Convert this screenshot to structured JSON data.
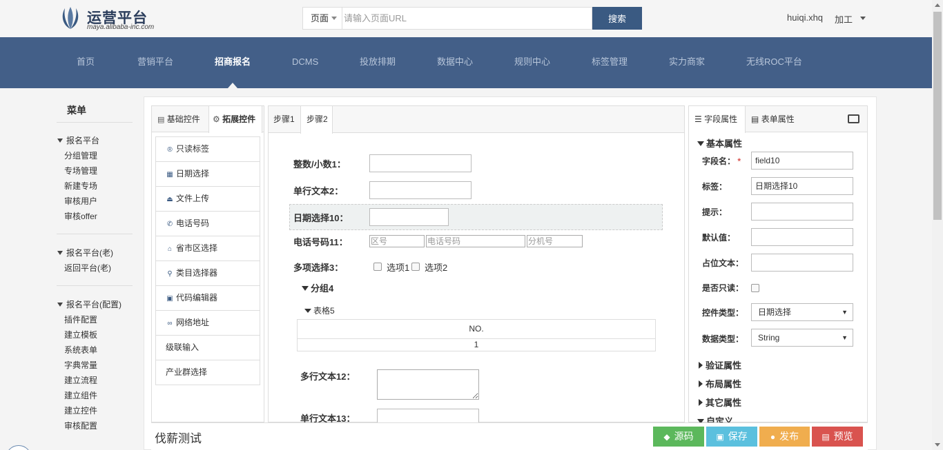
{
  "header": {
    "logo_title": "运营平台",
    "logo_subtitle": "maya.alibaba-inc.com",
    "search_scope": "页面",
    "search_placeholder": "请输入页面URL",
    "search_button": "搜索",
    "user": "huiqi.xhq",
    "process_menu": "加工"
  },
  "nav": {
    "items": [
      "首页",
      "营销平台",
      "招商报名",
      "DCMS",
      "投放排期",
      "数据中心",
      "规则中心",
      "标签管理",
      "实力商家",
      "无线ROC平台"
    ],
    "active": "招商报名"
  },
  "sidebar": {
    "title": "菜单",
    "groups": [
      {
        "label": "报名平台",
        "items": [
          "分组管理",
          "专场管理",
          "新建专场",
          "审核用户",
          "审核offer"
        ]
      },
      {
        "label": "报名平台(老)",
        "items": [
          "返回平台(老)"
        ]
      },
      {
        "label": "报名平台(配置)",
        "items": [
          "插件配置",
          "建立模板",
          "系统表单",
          "字典常量",
          "建立流程",
          "建立组件",
          "建立控件",
          "审核配置"
        ]
      }
    ]
  },
  "left_panel": {
    "tabs": [
      "基础控件",
      "拓展控件"
    ],
    "active_tab": "拓展控件",
    "controls": [
      {
        "label": "只读标签",
        "icon": "readonly-icon"
      },
      {
        "label": "日期选择",
        "icon": "calendar-icon"
      },
      {
        "label": "文件上传",
        "icon": "upload-icon"
      },
      {
        "label": "电话号码",
        "icon": "phone-icon"
      },
      {
        "label": "省市区选择",
        "icon": "region-icon"
      },
      {
        "label": "类目选择器",
        "icon": "category-icon"
      },
      {
        "label": "代码编辑器",
        "icon": "code-icon"
      },
      {
        "label": "网络地址",
        "icon": "link-icon"
      },
      {
        "label": "级联输入",
        "icon": ""
      },
      {
        "label": "产业群选择",
        "icon": ""
      }
    ]
  },
  "canvas": {
    "tabs": [
      "步骤1",
      "步骤2"
    ],
    "active_tab": "步骤2",
    "fields": {
      "int_label": "整数/小数1：",
      "text2_label": "单行文本2：",
      "date10_label": "日期选择10：",
      "phone11_label": "电话号码11：",
      "phone_area_placeholder": "区号",
      "phone_number_placeholder": "电话号码",
      "phone_ext_placeholder": "分机号",
      "multi3_label": "多项选择3：",
      "option1": "选项1",
      "option2": "选项2",
      "group4": "分组4",
      "table5": "表格5",
      "table_header": "NO.",
      "table_cell": "1",
      "textarea12_label": "多行文本12：",
      "text13_label": "单行文本13："
    }
  },
  "right_panel": {
    "tabs": [
      "字段属性",
      "表单属性"
    ],
    "active_tab": "字段属性",
    "basic_section": "基本属性",
    "props": {
      "name_label": "字段名：",
      "required_mark": "*",
      "name_value": "field10",
      "label_label": "标签：",
      "label_value": "日期选择10",
      "hint_label": "提示：",
      "default_label": "默认值：",
      "placeholder_label": "占位文本：",
      "readonly_label": "是否只读：",
      "control_type_label": "控件类型：",
      "control_type_value": "日期选择",
      "data_type_label": "数据类型：",
      "data_type_value": "String"
    },
    "collapsed_sections": [
      "验证属性",
      "布局属性",
      "其它属性"
    ],
    "custom_section": "自定义"
  },
  "footer": {
    "form_title": "伐薪测试",
    "buttons": {
      "source": "源码",
      "save": "保存",
      "publish": "发布",
      "preview": "预览"
    }
  },
  "colors": {
    "nav_bg": "#435f88",
    "search_btn": "#3a5a82",
    "source_btn": "#5cb85c",
    "save_btn": "#5bc0de",
    "publish_btn": "#f0ad4e",
    "preview_btn": "#d9534f"
  }
}
